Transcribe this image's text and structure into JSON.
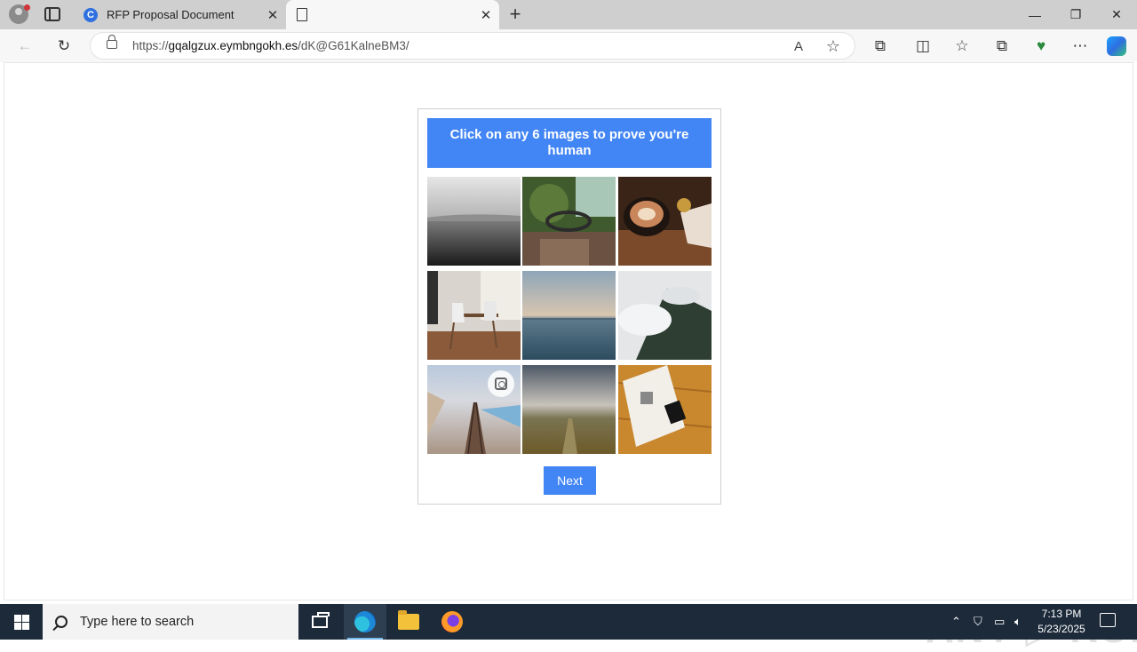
{
  "browser": {
    "tabs": [
      {
        "title": "RFP Proposal Document",
        "favicon": "c-logo-icon",
        "active": false
      },
      {
        "title": "",
        "favicon": "page-icon",
        "active": true
      }
    ],
    "close_glyph": "✕",
    "new_tab_glyph": "+",
    "window_controls": {
      "minimize": "—",
      "restore": "❐",
      "close": "✕"
    },
    "nav": {
      "back": "←",
      "reload": "↻"
    },
    "url": {
      "scheme": "https://",
      "host": "gqalgzux.eymbngokh.es",
      "path": "/dK@G61KalneBM3/"
    },
    "address_icons": {
      "read_aloud": "A",
      "favorite": "☆"
    },
    "toolbar_icons": {
      "extensions": "⧉",
      "split": "◫",
      "favorites": "☆",
      "collections": "⧉",
      "browser_essentials": "♥",
      "more": "⋯"
    }
  },
  "captcha": {
    "instruction": "Click on any 6 images to prove you're human",
    "tiles": [
      {
        "subject": "misty sea black and white"
      },
      {
        "subject": "old vehicle interior with greenery"
      },
      {
        "subject": "coffee cup on wooden table"
      },
      {
        "subject": "dining room with chairs"
      },
      {
        "subject": "calm sea at dusk"
      },
      {
        "subject": "mountain covered in clouds"
      },
      {
        "subject": "railway track by the coast"
      },
      {
        "subject": "field under cloudy sky"
      },
      {
        "subject": "magazine on wooden table"
      }
    ],
    "next_label": "Next"
  },
  "watermark": "ANY ▷ RUN",
  "taskbar": {
    "search_placeholder": "Type here to search",
    "time": "7:13 PM",
    "date": "5/23/2025"
  }
}
